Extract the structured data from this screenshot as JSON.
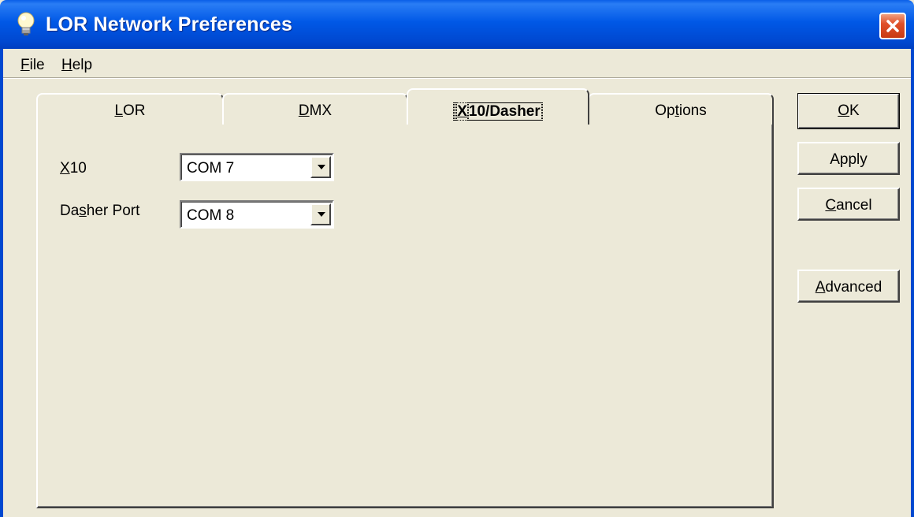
{
  "window": {
    "title": "LOR Network Preferences",
    "icon": "lightbulb-icon",
    "close_icon": "close-icon"
  },
  "menu": {
    "file": {
      "underline": "F",
      "rest": "ile"
    },
    "help": {
      "underline": "H",
      "rest": "elp"
    }
  },
  "tabs": {
    "lor": {
      "pre": "",
      "underline": "L",
      "rest": "OR"
    },
    "dmx": {
      "pre": "",
      "underline": "D",
      "rest": "MX"
    },
    "x10dasher": {
      "pre": "",
      "underline": "X",
      "rest": "10/Dasher",
      "active": true
    },
    "options": {
      "pre": "Op",
      "underline": "t",
      "rest": "ions"
    }
  },
  "form": {
    "x10": {
      "label_underline": "X",
      "label_rest": "10",
      "value": "COM 7"
    },
    "dasher": {
      "label_pre": "Da",
      "label_underline": "s",
      "label_rest": "her Port",
      "value": "COM 8"
    }
  },
  "buttons": {
    "ok": {
      "underline": "O",
      "rest": "K"
    },
    "apply": {
      "label": "Apply"
    },
    "cancel": {
      "underline": "C",
      "rest": "ancel"
    },
    "advanced": {
      "underline": "A",
      "rest": "dvanced"
    }
  },
  "colors": {
    "titlebar": "#0058e6",
    "face": "#ece9d8",
    "close": "#e0502a"
  }
}
